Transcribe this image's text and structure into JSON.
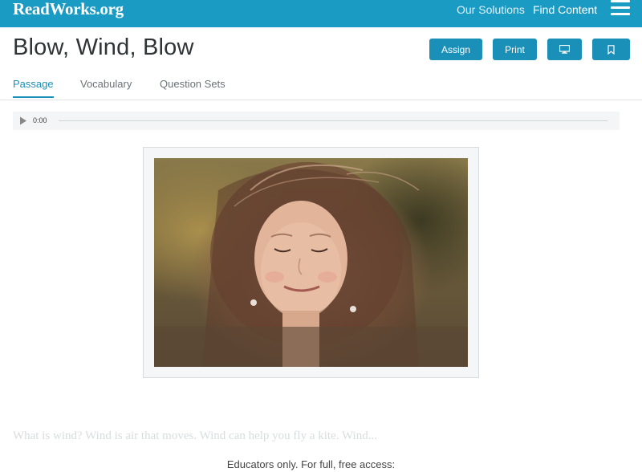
{
  "nav": {
    "logo": "ReadWorks.org",
    "links": [
      "Our Solutions",
      "Find Content"
    ],
    "menu_icon": "hamburger-menu-icon"
  },
  "header": {
    "title": "Blow, Wind, Blow",
    "buttons": {
      "assign": "Assign",
      "print": "Print",
      "present_icon": "monitor-icon",
      "save_icon": "bookmark-icon"
    }
  },
  "tabs": [
    {
      "label": "Passage",
      "active": true
    },
    {
      "label": "Vocabulary",
      "active": false
    },
    {
      "label": "Question Sets",
      "active": false
    }
  ],
  "audio": {
    "time": "0:00",
    "progress": 0
  },
  "passage": {
    "teaser": "What is wind? Wind is air that moves. Wind can help you fly a kite. Wind...",
    "access_note": "Educators only. For full, free access:"
  },
  "colors": {
    "brand": "#1a9bc4",
    "button": "#1a8fb8",
    "tab_active": "#1a8fb8"
  }
}
